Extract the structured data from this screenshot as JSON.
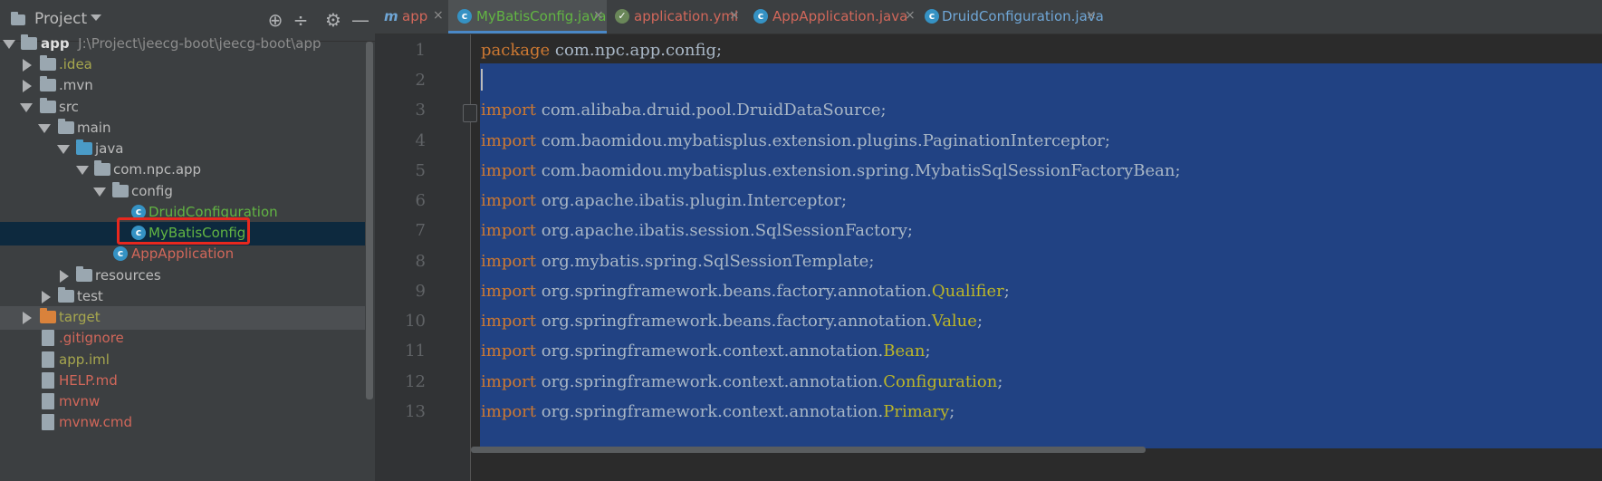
{
  "project_panel": {
    "title": "Project",
    "tree": [
      {
        "label": "app",
        "path": "J:\\Project\\jeecg-boot\\jeecg-boot\\app"
      },
      {
        "label": ".idea"
      },
      {
        "label": ".mvn"
      },
      {
        "label": "src"
      },
      {
        "label": "main"
      },
      {
        "label": "java"
      },
      {
        "label": "com.npc.app"
      },
      {
        "label": "config"
      },
      {
        "label": "DruidConfiguration"
      },
      {
        "label": "MyBatisConfig"
      },
      {
        "label": "AppApplication"
      },
      {
        "label": "resources"
      },
      {
        "label": "test"
      },
      {
        "label": "target"
      },
      {
        "label": ".gitignore"
      },
      {
        "label": "app.iml"
      },
      {
        "label": "HELP.md"
      },
      {
        "label": "mvnw"
      },
      {
        "label": "mvnw.cmd"
      }
    ]
  },
  "tabs": [
    {
      "label": "app",
      "close": "×"
    },
    {
      "label": "MyBatisConfig.java",
      "close": "×"
    },
    {
      "label": "application.yml",
      "close": "×"
    },
    {
      "label": "AppApplication.java",
      "close": "×"
    },
    {
      "label": "DruidConfiguration.java",
      "close": "×"
    }
  ],
  "editor": {
    "line_numbers": [
      "1",
      "2",
      "3",
      "4",
      "5",
      "6",
      "7",
      "8",
      "9",
      "10",
      "11",
      "12",
      "13"
    ],
    "lines": [
      {
        "kw": "package",
        "body": " com.npc.app.config;",
        "ann": "",
        "end": ""
      },
      {
        "kw": "",
        "body": "",
        "ann": "",
        "end": ""
      },
      {
        "kw": "import",
        "body": " com.alibaba.druid.pool.DruidDataSource;",
        "ann": "",
        "end": ""
      },
      {
        "kw": "import",
        "body": " com.baomidou.mybatisplus.extension.plugins.PaginationInterceptor;",
        "ann": "",
        "end": ""
      },
      {
        "kw": "import",
        "body": " com.baomidou.mybatisplus.extension.spring.MybatisSqlSessionFactoryBean;",
        "ann": "",
        "end": ""
      },
      {
        "kw": "import",
        "body": " org.apache.ibatis.plugin.Interceptor;",
        "ann": "",
        "end": ""
      },
      {
        "kw": "import",
        "body": " org.apache.ibatis.session.SqlSessionFactory;",
        "ann": "",
        "end": ""
      },
      {
        "kw": "import",
        "body": " org.mybatis.spring.SqlSessionTemplate;",
        "ann": "",
        "end": ""
      },
      {
        "kw": "import",
        "body": " org.springframework.beans.factory.annotation.",
        "ann": "Qualifier",
        "end": ";"
      },
      {
        "kw": "import",
        "body": " org.springframework.beans.factory.annotation.",
        "ann": "Value",
        "end": ";"
      },
      {
        "kw": "import",
        "body": " org.springframework.context.annotation.",
        "ann": "Bean",
        "end": ";"
      },
      {
        "kw": "import",
        "body": " org.springframework.context.annotation.",
        "ann": "Configuration",
        "end": ";"
      },
      {
        "kw": "import",
        "body": " org.springframework.context.annotation.",
        "ann": "Primary",
        "end": ";"
      }
    ]
  },
  "colors": {
    "keyword": "#cc7832",
    "annotation": "#bbb529",
    "selection": "#214283",
    "highlight_box": "#e8281e",
    "modified_file": "#62b543",
    "untracked_file": "#d1675a",
    "ignored_file": "#a7a74e"
  }
}
